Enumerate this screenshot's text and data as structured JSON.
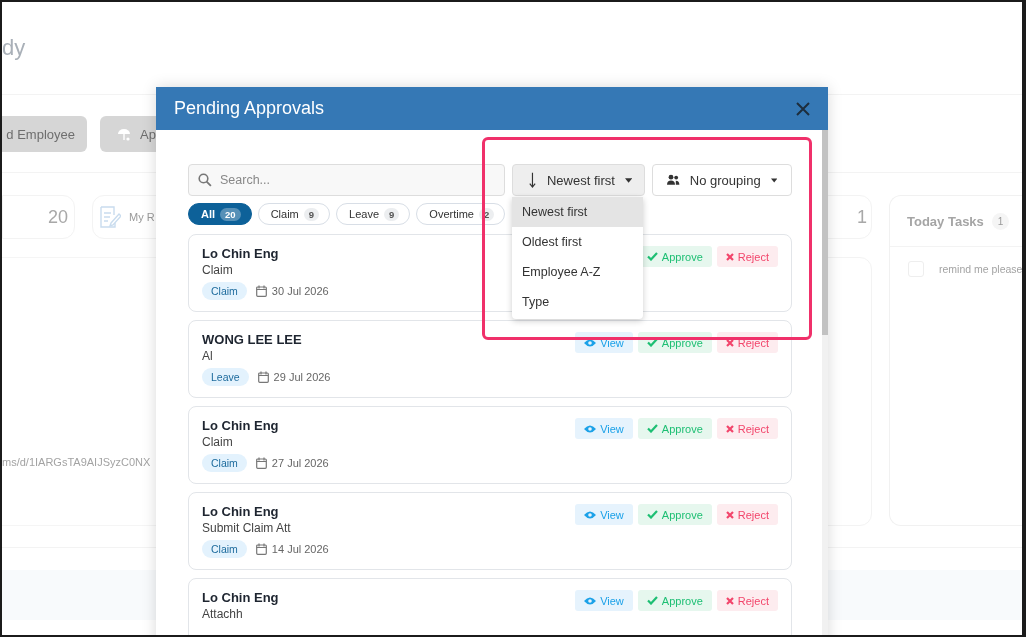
{
  "background": {
    "title": "dy",
    "buttons": [
      {
        "label": "d Employee",
        "kind": "plain"
      },
      {
        "label": "Ap",
        "kind": "umbrella"
      }
    ],
    "stat_cards": [
      {
        "kind": "number",
        "text": "20"
      },
      {
        "kind": "document",
        "text": "My R"
      },
      {
        "kind": "number",
        "text": "1"
      }
    ],
    "link_text": "ms/d/1IARGsTA9AIJSyzC0NX",
    "today_tasks": {
      "title": "Today Tasks",
      "count": "1",
      "tasks": [
        {
          "text": "remind me please",
          "checked": false
        }
      ]
    }
  },
  "modal": {
    "title": "Pending Approvals",
    "search": {
      "placeholder": "Search..."
    },
    "sort": {
      "label": "Newest first",
      "expanded": true,
      "options": [
        {
          "label": "Newest first",
          "selected": true
        },
        {
          "label": "Oldest first",
          "selected": false
        },
        {
          "label": "Employee A-Z",
          "selected": false
        },
        {
          "label": "Type",
          "selected": false
        }
      ]
    },
    "grouping": {
      "label": "No grouping"
    },
    "filters": [
      {
        "label": "All",
        "count": "20",
        "selected": true
      },
      {
        "label": "Claim",
        "count": "9",
        "selected": false
      },
      {
        "label": "Leave",
        "count": "9",
        "selected": false
      },
      {
        "label": "Overtime",
        "count": "2",
        "selected": false
      }
    ],
    "requests": [
      {
        "name": "Lo Chin Eng",
        "subtitle": "Claim",
        "tag": "Claim",
        "date": "30 Jul 2026",
        "actions": [
          {
            "kind": "approve",
            "label": "Approve"
          },
          {
            "kind": "reject",
            "label": "Reject"
          }
        ]
      },
      {
        "name": "WONG LEE LEE",
        "subtitle": "Al",
        "tag": "Leave",
        "date": "29 Jul 2026",
        "actions": [
          {
            "kind": "view",
            "label": "View"
          },
          {
            "kind": "approve",
            "label": "Approve"
          },
          {
            "kind": "reject",
            "label": "Reject"
          }
        ]
      },
      {
        "name": "Lo Chin Eng",
        "subtitle": "Claim",
        "tag": "Claim",
        "date": "27 Jul 2026",
        "actions": [
          {
            "kind": "view",
            "label": "View"
          },
          {
            "kind": "approve",
            "label": "Approve"
          },
          {
            "kind": "reject",
            "label": "Reject"
          }
        ]
      },
      {
        "name": "Lo Chin Eng",
        "subtitle": "Submit Claim Att",
        "tag": "Claim",
        "date": "14 Jul 2026",
        "actions": [
          {
            "kind": "view",
            "label": "View"
          },
          {
            "kind": "approve",
            "label": "Approve"
          },
          {
            "kind": "reject",
            "label": "Reject"
          }
        ]
      },
      {
        "name": "Lo Chin Eng",
        "subtitle": "Attachh",
        "actions": [
          {
            "kind": "view",
            "label": "View"
          },
          {
            "kind": "approve",
            "label": "Approve"
          },
          {
            "kind": "reject",
            "label": "Reject"
          }
        ]
      }
    ]
  }
}
